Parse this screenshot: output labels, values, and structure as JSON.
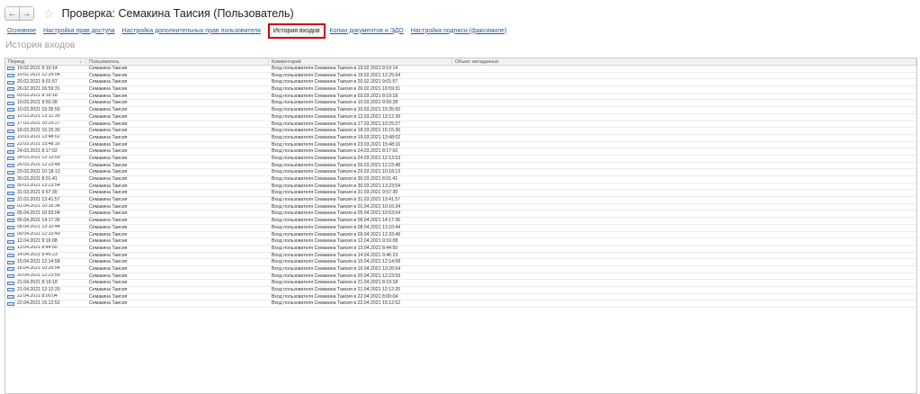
{
  "window": {
    "title": "Проверка: Семакина Таисия (Пользователь)",
    "back_icon": "arrow-left-icon",
    "forward_icon": "arrow-right-icon",
    "star_icon": "star-icon"
  },
  "tabs": [
    {
      "label": "Основное",
      "active": false
    },
    {
      "label": "Настройка прав доступа",
      "active": false
    },
    {
      "label": "Настройка дополнительных прав пользователя",
      "active": false
    },
    {
      "label": "История входов",
      "active": true
    },
    {
      "label": "Копии документов и ЭДО",
      "active": false
    },
    {
      "label": "Настройка подписи (факсимиле)",
      "active": false
    }
  ],
  "section_title": "История входов",
  "colors": {
    "link": "#2a5a98",
    "active_tab_border": "#d00000",
    "row_icon": "#4a7fc0"
  },
  "grid": {
    "columns": [
      "Период",
      "Пользователь",
      "Комментарий",
      "Объект метаданных"
    ],
    "sort_indicator": "↓",
    "rows": [
      {
        "period": "19.02.2021 9:10:14",
        "user": "Семакина Таисия",
        "comment": "Вход пользователя Семакина Таисия в 19.02.2021 9:10:14",
        "object": ""
      },
      {
        "period": "19.02.2021 12:25:04",
        "user": "Семакина Таисия",
        "comment": "Вход пользователя Семакина Таисия в 19.02.2021 12:25:04",
        "object": ""
      },
      {
        "period": "20.02.2021 9:01:57",
        "user": "Семакина Таисия",
        "comment": "Вход пользователя Семакина Таисия в 20.02.2021 9:01:57",
        "object": ""
      },
      {
        "period": "26.02.2021 16:59:31",
        "user": "Семакина Таисия",
        "comment": "Вход пользователя Семакина Таисия в 26.02.2021 16:59:31",
        "object": ""
      },
      {
        "period": "03.03.2021 8:19:18",
        "user": "Семакина Таисия",
        "comment": "Вход пользователя Семакина Таисия в 03.03.2021 8:19:18",
        "object": ""
      },
      {
        "period": "10.03.2021 9:50:28",
        "user": "Семакина Таисия",
        "comment": "Вход пользователя Семакина Таисия в 10.03.2021 9:50:28",
        "object": ""
      },
      {
        "period": "10.03.2021 15:35:50",
        "user": "Семакина Таисия",
        "comment": "Вход пользователя Семакина Таисия в 10.03.2021 15:35:50",
        "object": ""
      },
      {
        "period": "12.03.2021 13:12:39",
        "user": "Семакина Таисия",
        "comment": "Вход пользователя Семакина Таисия в 12.03.2021 13:12:39",
        "object": ""
      },
      {
        "period": "17.03.2021 10:25:27",
        "user": "Семакина Таисия",
        "comment": "Вход пользователя Семакина Таисия в 17.03.2021 10:25:27",
        "object": ""
      },
      {
        "period": "18.03.2021 15:15:30",
        "user": "Семакина Таисия",
        "comment": "Вход пользователя Семакина Таисия в 18.03.2021 15:15:30",
        "object": ""
      },
      {
        "period": "19.03.2021 13:48:02",
        "user": "Семакина Таисия",
        "comment": "Вход пользователя Семакина Таисия в 19.03.2021 13:48:02",
        "object": ""
      },
      {
        "period": "23.03.2021 15:48:16",
        "user": "Семакина Таисия",
        "comment": "Вход пользователя Семакина Таисия в 23.03.2021 15:48:16",
        "object": ""
      },
      {
        "period": "24.03.2021 8:17:02",
        "user": "Семакина Таисия",
        "comment": "Вход пользователя Семакина Таисия в 24.03.2021 8:17:02",
        "object": ""
      },
      {
        "period": "24.03.2021 12:13:53",
        "user": "Семакина Таисия",
        "comment": "Вход пользователя Семакина Таисия в 24.03.2021 12:13:53",
        "object": ""
      },
      {
        "period": "26.03.2021 12:23:48",
        "user": "Семакина Таисия",
        "comment": "Вход пользователя Семакина Таисия в 26.03.2021 12:23:48",
        "object": ""
      },
      {
        "period": "29.03.2021 10:18:13",
        "user": "Семакина Таисия",
        "comment": "Вход пользователя Семакина Таисия в 29.03.2021 10:18:13",
        "object": ""
      },
      {
        "period": "30.03.2021 8:01:41",
        "user": "Семакина Таисия",
        "comment": "Вход пользователя Семакина Таисия в 30.03.2021 8:01:41",
        "object": ""
      },
      {
        "period": "30.03.2021 13:23:54",
        "user": "Семакина Таисия",
        "comment": "Вход пользователя Семакина Таисия в 30.03.2021 13:23:54",
        "object": ""
      },
      {
        "period": "31.03.2021 9:57:30",
        "user": "Семакина Таисия",
        "comment": "Вход пользователя Семакина Таисия в 31.03.2021 9:57:30",
        "object": ""
      },
      {
        "period": "31.03.2021 13:41:57",
        "user": "Семакина Таисия",
        "comment": "Вход пользователя Семакина Таисия в 31.03.2021 13:41:57",
        "object": ""
      },
      {
        "period": "01.04.2021 10:16:34",
        "user": "Семакина Таисия",
        "comment": "Вход пользователя Семакина Таисия в 01.04.2021 10:16:34",
        "object": ""
      },
      {
        "period": "05.04.2021 10:53:04",
        "user": "Семакина Таисия",
        "comment": "Вход пользователя Семакина Таисия в 05.04.2021 10:53:04",
        "object": ""
      },
      {
        "period": "06.04.2021 14:17:36",
        "user": "Семакина Таисия",
        "comment": "Вход пользователя Семакина Таисия в 06.04.2021 14:17:36",
        "object": ""
      },
      {
        "period": "08.04.2021 13:10:44",
        "user": "Семакина Таисия",
        "comment": "Вход пользователя Семакина Таисия в 08.04.2021 13:10:44",
        "object": ""
      },
      {
        "period": "09.04.2021 12:33:49",
        "user": "Семакина Таисия",
        "comment": "Вход пользователя Семакина Таисия в 09.04.2021 12:33:49",
        "object": ""
      },
      {
        "period": "12.04.2021 9:16:08",
        "user": "Семакина Таисия",
        "comment": "Вход пользователя Семакина Таисия в 12.04.2021 9:16:08",
        "object": ""
      },
      {
        "period": "13.04.2021 8:44:50",
        "user": "Семакина Таисия",
        "comment": "Вход пользователя Семакина Таисия в 13.04.2021 8:44:50",
        "object": ""
      },
      {
        "period": "14.04.2021 9:46:23",
        "user": "Семакина Таисия",
        "comment": "Вход пользователя Семакина Таисия в 14.04.2021 9:46:23",
        "object": ""
      },
      {
        "period": "15.04.2021 12:14:58",
        "user": "Семакина Таисия",
        "comment": "Вход пользователя Семакина Таисия в 15.04.2021 12:14:58",
        "object": ""
      },
      {
        "period": "16.04.2021 10:26:54",
        "user": "Семакина Таисия",
        "comment": "Вход пользователя Семакина Таисия в 16.04.2021 10:26:54",
        "object": ""
      },
      {
        "period": "20.04.2021 12:23:59",
        "user": "Семакина Таисия",
        "comment": "Вход пользователя Семакина Таисия в 20.04.2021 12:23:59",
        "object": ""
      },
      {
        "period": "21.04.2021 8:19:18",
        "user": "Семакина Таисия",
        "comment": "Вход пользователя Семакина Таисия в 21.04.2021 8:19:18",
        "object": ""
      },
      {
        "period": "21.04.2021 12:12:20",
        "user": "Семакина Таисия",
        "comment": "Вход пользователя Семакина Таисия в 21.04.2021 12:12:20",
        "object": ""
      },
      {
        "period": "22.04.2021 8:00:04",
        "user": "Семакина Таисия",
        "comment": "Вход пользователя Семакина Таисия в 22.04.2021 8:00:04",
        "object": ""
      },
      {
        "period": "22.04.2021 15:12:52",
        "user": "Семакина Таисия",
        "comment": "Вход пользователя Семакина Таисия в 22.04.2021 15:12:52",
        "object": ""
      }
    ]
  }
}
